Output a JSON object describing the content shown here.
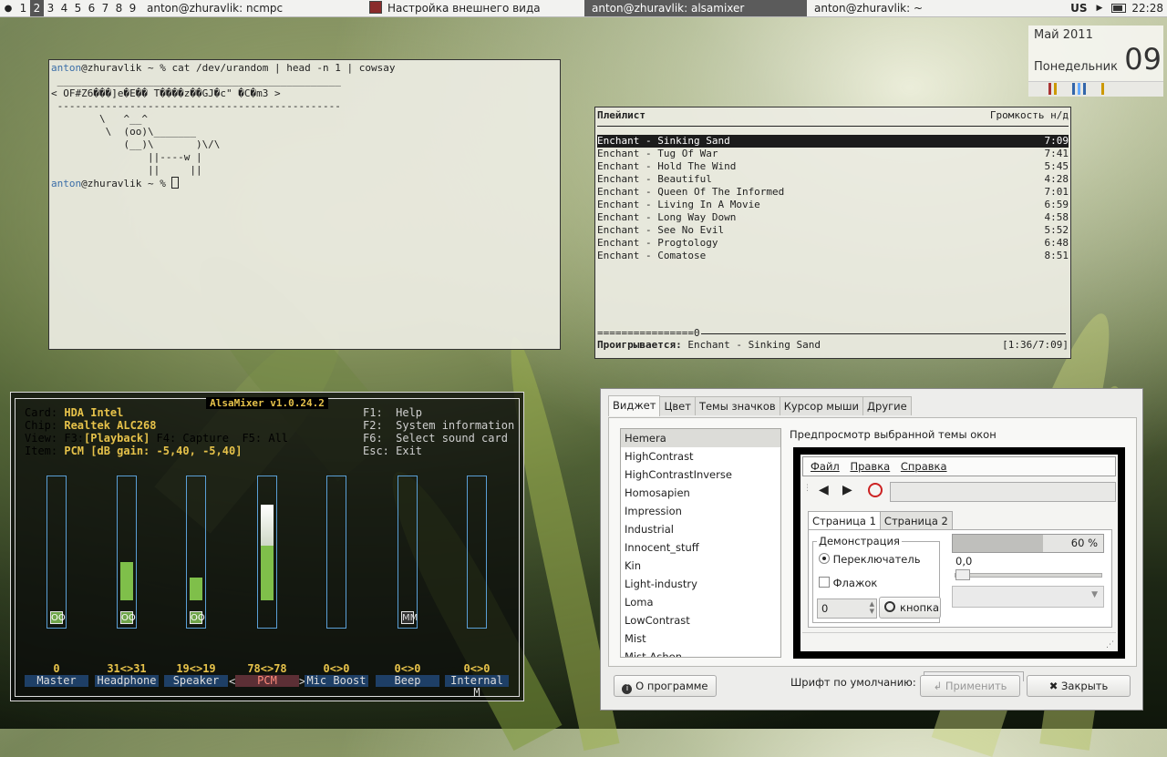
{
  "panel": {
    "workspaces": [
      "1",
      "2",
      "3",
      "4",
      "5",
      "6",
      "7",
      "8",
      "9"
    ],
    "active_workspace": "2",
    "tasks": [
      {
        "title": "anton@zhuravlik: ncmpc",
        "active": false
      },
      {
        "title": "Настройка внешнего вида",
        "active": false
      },
      {
        "title": "anton@zhuravlik: alsamixer",
        "active": true
      },
      {
        "title": "anton@zhuravlik: ~",
        "active": false
      }
    ],
    "layout": "US",
    "clock": "22:28"
  },
  "calendar": {
    "month": "Май 2011",
    "weekday": "Понедельник",
    "day": "09"
  },
  "terminal": {
    "user": "anton",
    "prompt_rest": "@zhuravlik ~ % cat /dev/urandom | head -n 1 | cowsay",
    "cowsay_top": " _______________________________________________",
    "cowsay_text": "< OF#Z6���]e�E�� T����z��GJ�c\" �C�m3 >",
    "cowsay_bottom": " -----------------------------------------------",
    "cow": "        \\   ^__^\n         \\  (oo)\\_______\n            (__)\\       )\\/\\\n                ||----w |\n                ||     ||",
    "prompt2_rest": "@zhuravlik ~ % "
  },
  "ncmpc": {
    "header_title": "Плейлист",
    "header_volume": "Громкость н/д",
    "playlist": [
      {
        "track": "Enchant - Sinking Sand",
        "time": "7:09",
        "selected": true
      },
      {
        "track": "Enchant - Tug Of War",
        "time": "7:41"
      },
      {
        "track": "Enchant - Hold The Wind",
        "time": "5:45"
      },
      {
        "track": "Enchant - Beautiful",
        "time": "4:28"
      },
      {
        "track": "Enchant - Queen Of The Informed",
        "time": "7:01"
      },
      {
        "track": "Enchant - Living In A Movie",
        "time": "6:59"
      },
      {
        "track": "Enchant - Long Way Down",
        "time": "4:58"
      },
      {
        "track": "Enchant - See No Evil",
        "time": "5:52"
      },
      {
        "track": "Enchant - Progtology",
        "time": "6:48"
      },
      {
        "track": "Enchant - Comatose",
        "time": "8:51"
      }
    ],
    "progress_text": "================0",
    "status_label": "Проигрывается:",
    "status_track": " Enchant - Sinking Sand",
    "status_time": "[1:36/7:09]"
  },
  "alsamixer": {
    "title": "AlsaMixer v1.0.24.2",
    "card_label": "Card:",
    "card_value": "HDA Intel",
    "chip_label": "Chip:",
    "chip_value": "Realtek ALC268",
    "view_label": "View:",
    "view_f3": "F3:",
    "view_playback": "[Playback]",
    "view_rest": " F4: Capture  F5: All",
    "item_label": "Item:",
    "item_value": "PCM [dB gain: -5,40, -5,40]",
    "help_keys": [
      "F1:  Help",
      "F2:  System information",
      "F6:  Select sound card",
      "Esc: Exit"
    ],
    "channels": [
      {
        "name": "Master",
        "value": "0",
        "level": 0,
        "switch": "OO"
      },
      {
        "name": "Headphone",
        "value": "31<>31",
        "level": 0.31,
        "switch": "OO"
      },
      {
        "name": "Speaker",
        "value": "19<>19",
        "level": 0.19,
        "switch": "OO"
      },
      {
        "name": "PCM",
        "value": "78<>78",
        "level": 0.78,
        "switch": "",
        "selected": true
      },
      {
        "name": "Mic Boost",
        "value": "0<>0",
        "level": 0,
        "switch": ""
      },
      {
        "name": "Beep",
        "value": "0<>0",
        "level": 0,
        "switch": "MM"
      },
      {
        "name": "Internal M",
        "value": "0<>0",
        "level": 0,
        "switch": ""
      }
    ]
  },
  "appearance": {
    "tabs": [
      "Виджет",
      "Цвет",
      "Темы значков",
      "Курсор мыши",
      "Другие"
    ],
    "active_tab": "Виджет",
    "themes": [
      "Hemera",
      "HighContrast",
      "HighContrastInverse",
      "Homosapien",
      "Impression",
      "Industrial",
      "Innocent_stuff",
      "Kin",
      "Light-industry",
      "Loma",
      "LowContrast",
      "Mist",
      "Mist-Ashen"
    ],
    "selected_theme": "Hemera",
    "preview_label": "Предпросмотр выбранной темы окон",
    "preview": {
      "menu": [
        "Файл",
        "Правка",
        "Справка"
      ],
      "tabs": [
        "Страница 1",
        "Страница 2"
      ],
      "frame_legend": "Демонстрация",
      "radio_label": "Переключатель",
      "check_label": "Флажок",
      "spin_value": "0",
      "button_label": "кнопка",
      "progress_text": "60 %",
      "progress": 0.6,
      "slider_value": "0,0"
    },
    "font_label": "Шрифт по умолчанию:",
    "about_button": "О программе",
    "apply_button": "Применить",
    "close_button": "Закрыть"
  },
  "colors": {
    "accent_blue": "#3b6ea8",
    "alsa_yellow": "#e6c24a",
    "alsa_green": "#7fbf4a"
  }
}
